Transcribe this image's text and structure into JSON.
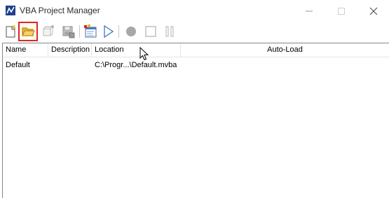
{
  "window": {
    "title": "VBA Project Manager"
  },
  "toolbar": {
    "buttons": [
      {
        "name": "new-project",
        "icon": "new-document-icon",
        "enabled": true
      },
      {
        "name": "open-project",
        "icon": "open-folder-icon",
        "enabled": true,
        "highlighted": true
      },
      {
        "name": "save-as-project",
        "icon": "save-as-icon",
        "enabled": false
      },
      {
        "name": "save-project",
        "icon": "save-icon",
        "enabled": false
      },
      {
        "name": "vba-editor",
        "icon": "vba-editor-icon",
        "enabled": true
      },
      {
        "name": "run-macro",
        "icon": "play-icon",
        "enabled": true
      },
      {
        "name": "record-macro",
        "icon": "record-icon",
        "enabled": false
      },
      {
        "name": "stop-recording",
        "icon": "stop-icon",
        "enabled": false
      },
      {
        "name": "pause-recording",
        "icon": "pause-icon",
        "enabled": false
      }
    ],
    "highlight_color": "#e0242a"
  },
  "list": {
    "columns": [
      "Name",
      "Description",
      "Location",
      "Auto-Load"
    ],
    "rows": [
      {
        "name": "Default",
        "description": "",
        "location": "C:\\Progr...\\Default.mvba",
        "autoload": ""
      }
    ]
  }
}
